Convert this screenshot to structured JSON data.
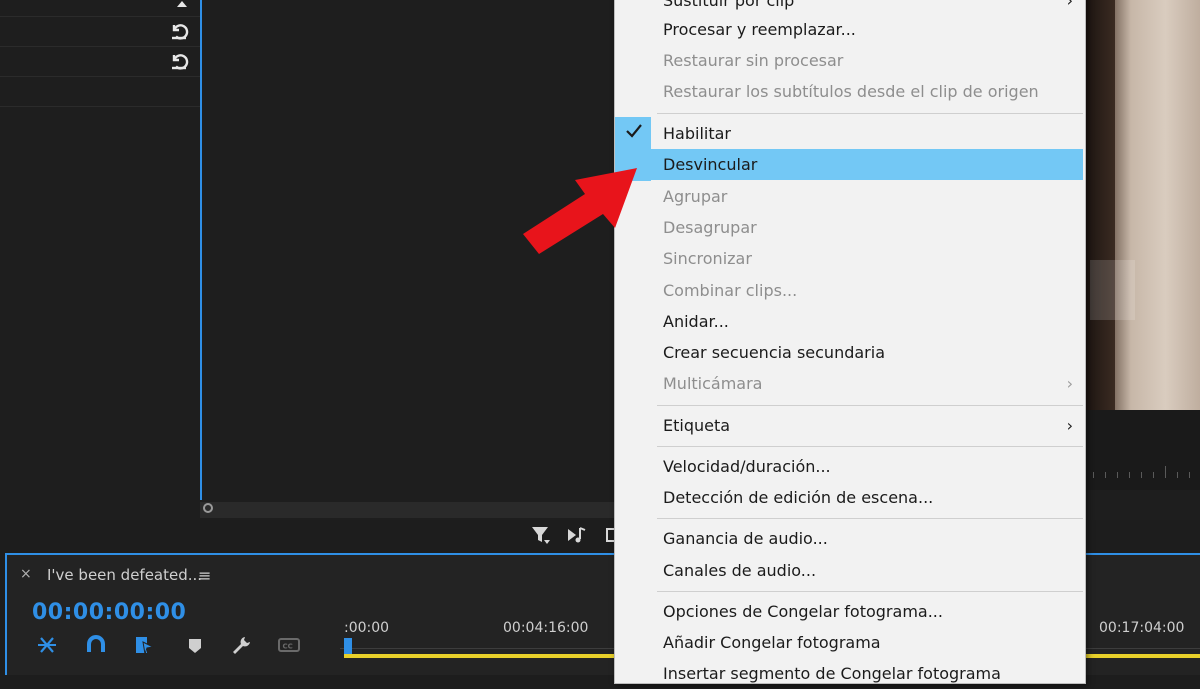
{
  "effect_panel": {
    "rows": [
      {
        "reset": true
      },
      {
        "reset": true
      }
    ]
  },
  "timeline": {
    "tab_title": "I've been defeated...",
    "tab_close": "×",
    "tab_menu": "≡",
    "timecode": "00:00:00:00",
    "ruler_labels": [
      ":00:00",
      "00:04:16:00",
      "00:17:04:00"
    ],
    "work_bar_color": "#e8d02a",
    "accent_color": "#2f8fe6"
  },
  "context_menu": {
    "highlight_color": "#73c8f5",
    "items": [
      {
        "label": "Sustituir por clip",
        "enabled": true,
        "submenu": true
      },
      {
        "label": "Procesar y reemplazar...",
        "enabled": true
      },
      {
        "label": "Restaurar sin procesar",
        "enabled": false
      },
      {
        "label": "Restaurar los subtítulos desde el clip de origen",
        "enabled": false
      },
      {
        "label": "Habilitar",
        "enabled": true,
        "checked": true
      },
      {
        "label": "Desvincular",
        "enabled": true,
        "highlighted": true
      },
      {
        "label": "Agrupar",
        "enabled": false
      },
      {
        "label": "Desagrupar",
        "enabled": false
      },
      {
        "label": "Sincronizar",
        "enabled": false
      },
      {
        "label": "Combinar clips...",
        "enabled": false
      },
      {
        "label": "Anidar...",
        "enabled": true
      },
      {
        "label": "Crear secuencia secundaria",
        "enabled": true
      },
      {
        "label": "Multicámara",
        "enabled": false,
        "submenu": true
      },
      {
        "label": "Etiqueta",
        "enabled": true,
        "submenu": true
      },
      {
        "label": "Velocidad/duración...",
        "enabled": true
      },
      {
        "label": "Detección de edición de escena...",
        "enabled": true
      },
      {
        "label": "Ganancia de audio...",
        "enabled": true
      },
      {
        "label": "Canales de audio...",
        "enabled": true
      },
      {
        "label": "Opciones de Congelar fotograma...",
        "enabled": true
      },
      {
        "label": "Añadir Congelar fotograma",
        "enabled": true
      },
      {
        "label": "Insertar segmento de Congelar fotograma",
        "enabled": true
      }
    ],
    "submenu_glyph": "›",
    "annotation_arrow_color": "#e8141b"
  }
}
